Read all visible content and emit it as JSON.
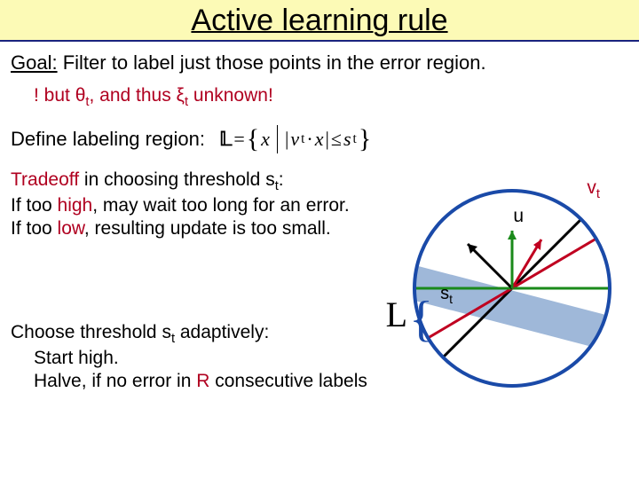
{
  "title": "Active learning rule",
  "goal_prefix": "Goal:",
  "goal_text": " Filter to label just those points in the error region.",
  "warning": "! but θt, and thus ξt unknown!",
  "define_label": "Define labeling region:",
  "formula": {
    "L": "𝕃",
    "eq": "=",
    "lb": "{",
    "x": "x",
    "bar": "|",
    "abs_l": "|",
    "vt": "v",
    "tsub": "t",
    "dot": " · ",
    "xv": "x",
    "abs_r": "|",
    "le": " ≤ ",
    "s": "s",
    "rb": "}"
  },
  "tradeoff": {
    "l1a": "Tradeoff",
    "l1b": " in choosing threshold s",
    "l1sub": "t",
    "l1c": ":",
    "l2a": "If too ",
    "l2b": "high",
    "l2c": ", may wait too long for an error.",
    "l3a": "If too ",
    "l3b": "low",
    "l3c": ", resulting update is too small."
  },
  "choose": {
    "l1a": "Choose threshold s",
    "l1sub": "t",
    "l1b": " adaptively:",
    "l2": "Start high.",
    "l3a": "Halve, if no error in ",
    "l3b": "R",
    "l3c": " consecutive labels"
  },
  "figure_labels": {
    "u": "u",
    "vt": "v",
    "st_s": "s",
    "L": "L",
    "brace": "{"
  }
}
